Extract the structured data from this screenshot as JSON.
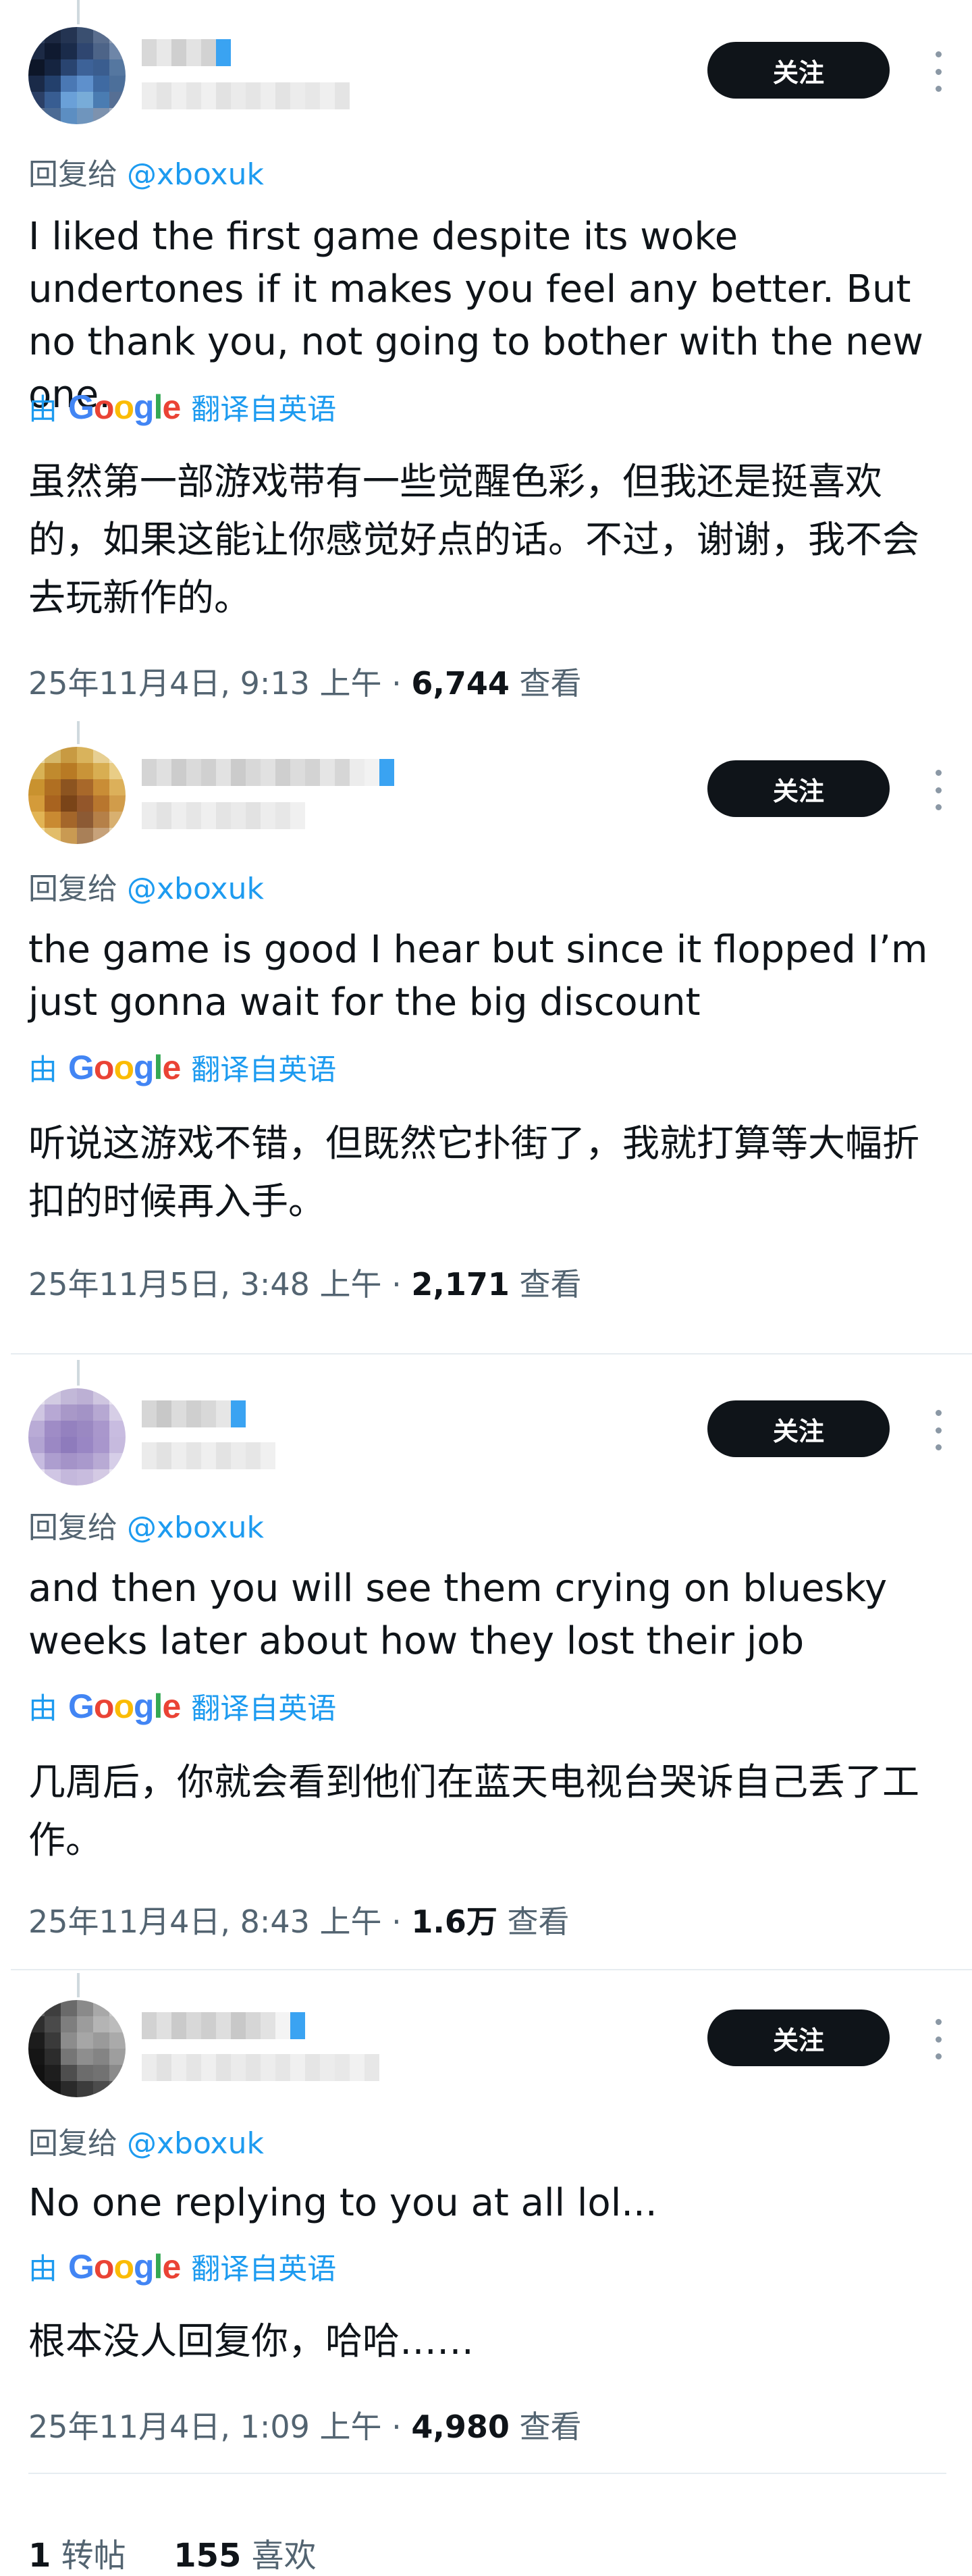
{
  "colors": {
    "accent": "#1d9bf0",
    "text": "#0f1419",
    "muted": "#536471",
    "button_bg": "#0f1419",
    "verified": "#3aa3f2",
    "google_blue": "#4285f4",
    "google_red": "#ea4335",
    "google_yellow": "#fbbc05",
    "google_green": "#34a853"
  },
  "replies": [
    {
      "follow_label": "关注",
      "reply_prefix": "回复给",
      "reply_handle": "@xboxuk",
      "text": "I liked the first game despite its woke undertones if it makes you feel any better. But no thank you, not going to bother with the new one.",
      "translate_prefix": "由",
      "translate_suffix": "翻译自英语",
      "translated_text": "虽然第一部游戏带有一些觉醒色彩，但我还是挺喜欢的，如果这能让你感觉好点的话。不过，谢谢，我不会去玩新作的。",
      "timestamp": "25年11月4日, 9:13 上午 · ",
      "views": "6,744",
      "views_label": " 查看"
    },
    {
      "follow_label": "关注",
      "reply_prefix": "回复给",
      "reply_handle": "@xboxuk",
      "text": "the game is good I hear but since it flopped I’m just gonna wait for the big discount",
      "translate_prefix": "由",
      "translate_suffix": "翻译自英语",
      "translated_text": "听说这游戏不错，但既然它扑街了，我就打算等大幅折扣的时候再入手。",
      "timestamp": "25年11月5日, 3:48 上午 · ",
      "views": "2,171",
      "views_label": " 查看"
    },
    {
      "follow_label": "关注",
      "reply_prefix": "回复给",
      "reply_handle": "@xboxuk",
      "text": "and then you will see them crying on bluesky weeks later about how they lost their job",
      "translate_prefix": "由",
      "translate_suffix": "翻译自英语",
      "translated_text": "几周后，你就会看到他们在蓝天电视台哭诉自己丢了工作。",
      "timestamp": "25年11月4日, 8:43 上午 · ",
      "views": "1.6万",
      "views_label": " 查看"
    },
    {
      "follow_label": "关注",
      "reply_prefix": "回复给",
      "reply_handle": "@xboxuk",
      "text": "No one replying to you at all lol...",
      "translate_prefix": "由",
      "translate_suffix": "翻译自英语",
      "translated_text": "根本没人回复你，哈哈……",
      "timestamp": "25年11月4日, 1:09 上午 · ",
      "views": "4,980",
      "views_label": " 查看"
    }
  ],
  "footer": {
    "reposts_count": "1",
    "reposts_label": " 转帖",
    "likes_count": "155",
    "likes_label": " 喜欢"
  }
}
